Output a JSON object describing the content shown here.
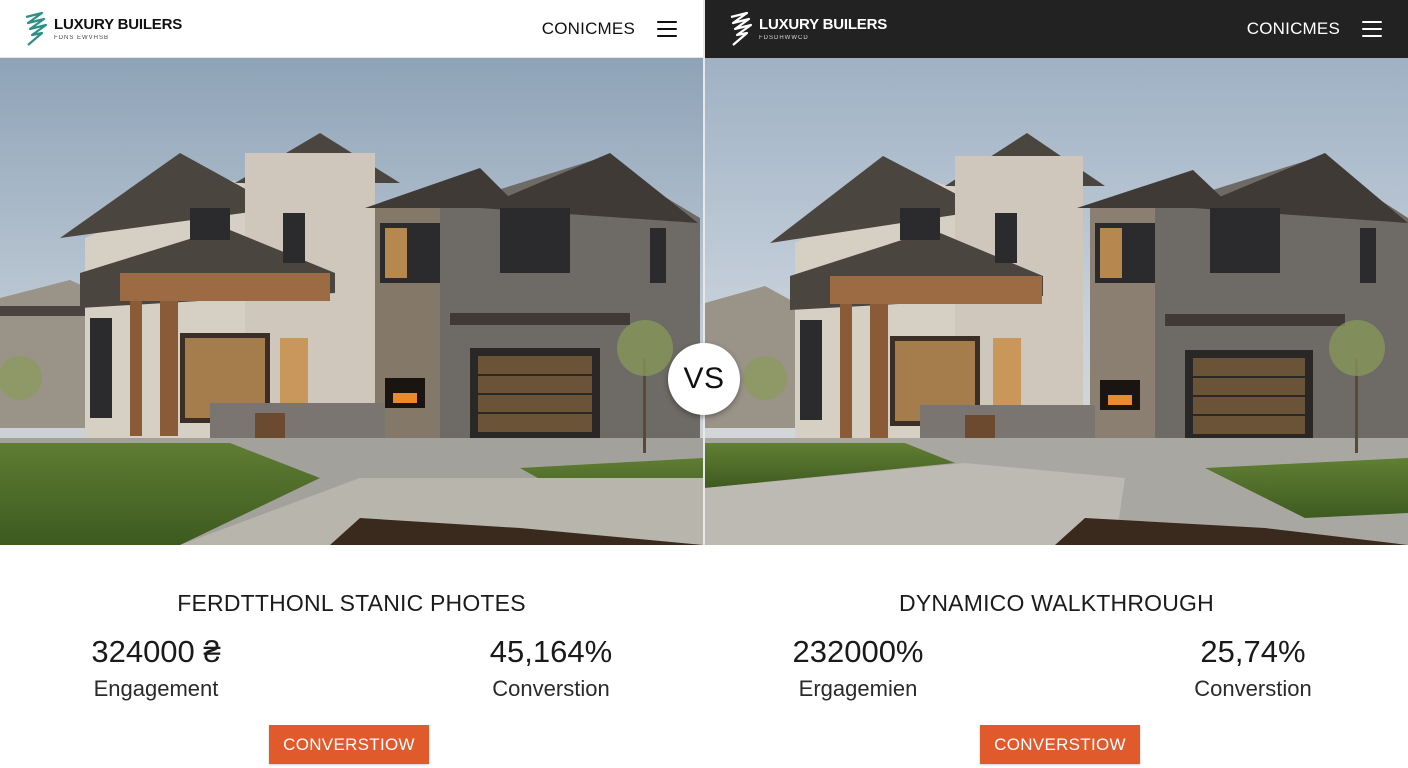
{
  "left": {
    "logo_name": "LUXURY BUILERS",
    "logo_sub": "FDNS EWVHSB",
    "nav_link": "CONICMES",
    "section_title": "FERDTTHONL STANIC PHOTES",
    "stats": [
      {
        "value": "324000 ₴",
        "label": "Engagement"
      },
      {
        "value": "45,164%",
        "label": "Converstion"
      }
    ],
    "cta_label": "CONVERSTIOW"
  },
  "right": {
    "logo_name": "LUXURY BUILERS",
    "logo_sub": "FDSDHWWCD",
    "nav_link": "CONICMES",
    "section_title": "DYNAMICO WALKTHROUGH",
    "stats": [
      {
        "value": "232000%",
        "label": "Ergagemien"
      },
      {
        "value": "25,74%",
        "label": "Converstion"
      }
    ],
    "cta_label": "CONVERSTIOW"
  },
  "vs_label": "VS",
  "icons": [
    "logo-mark-icon",
    "hamburger-menu-icon"
  ],
  "colors": {
    "accent": "#e05a2b",
    "dark_nav": "#222222",
    "logo_teal": "#2f8f87"
  }
}
